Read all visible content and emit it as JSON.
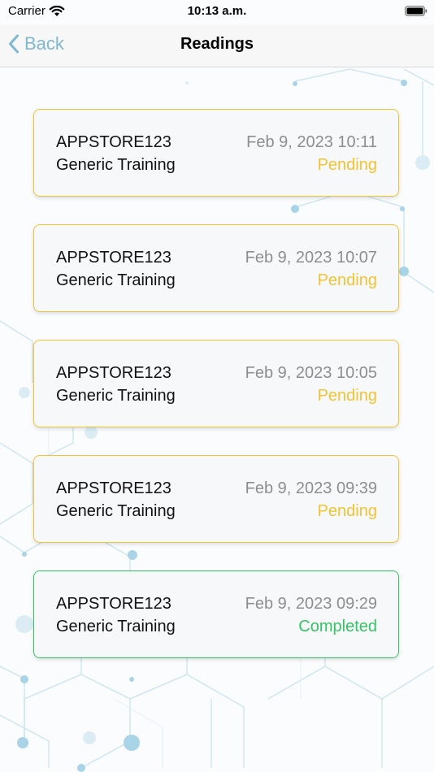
{
  "status_bar": {
    "carrier": "Carrier",
    "time": "10:13 a.m."
  },
  "nav": {
    "back_label": "Back",
    "title": "Readings"
  },
  "readings": [
    {
      "device": "APPSTORE123",
      "training": "Generic Training",
      "date": "Feb 9, 2023 10:11",
      "status": "Pending"
    },
    {
      "device": "APPSTORE123",
      "training": "Generic Training",
      "date": "Feb 9, 2023 10:07",
      "status": "Pending"
    },
    {
      "device": "APPSTORE123",
      "training": "Generic Training",
      "date": "Feb 9, 2023 10:05",
      "status": "Pending"
    },
    {
      "device": "APPSTORE123",
      "training": "Generic Training",
      "date": "Feb 9, 2023 09:39",
      "status": "Pending"
    },
    {
      "device": "APPSTORE123",
      "training": "Generic Training",
      "date": "Feb 9, 2023 09:29",
      "status": "Completed"
    }
  ],
  "colors": {
    "accent": "#7fb8d1",
    "pending": "#f3c333",
    "completed": "#35c463",
    "date_text": "#8e8e8e"
  },
  "icons": {
    "wifi": "wifi-icon",
    "battery": "battery-icon",
    "back": "chevron-left-icon"
  }
}
